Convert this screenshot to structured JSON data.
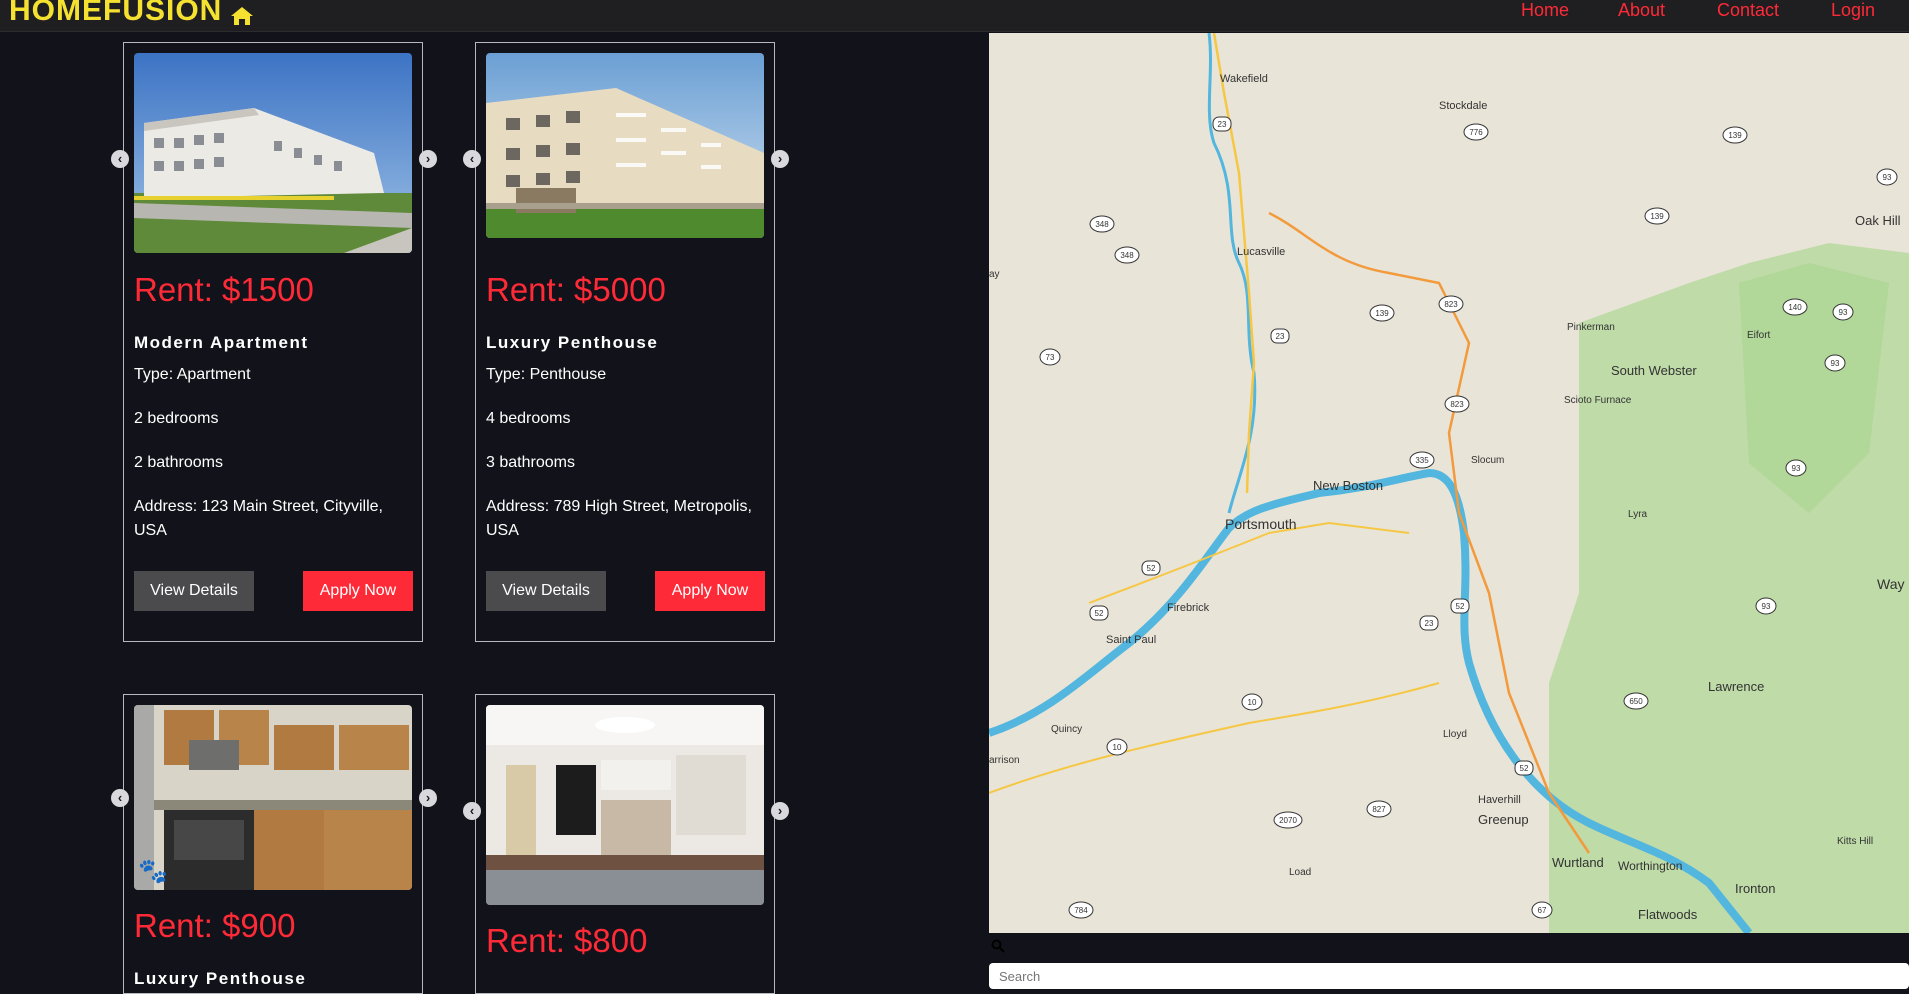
{
  "header": {
    "brand": "HOMEFUSION",
    "nav": [
      "Home",
      "About",
      "Contact",
      "Login"
    ]
  },
  "listings": [
    {
      "rent": "Rent: $1500",
      "title": "Modern Apartment",
      "type": "Type: Apartment",
      "bedrooms": "2 bedrooms",
      "bathrooms": "2 bathrooms",
      "address": "Address: 123 Main Street, Cityville, USA",
      "details_label": "View Details",
      "apply_label": "Apply Now"
    },
    {
      "rent": "Rent: $5000",
      "title": "Luxury Penthouse",
      "type": "Type: Penthouse",
      "bedrooms": "4 bedrooms",
      "bathrooms": "3 bathrooms",
      "address": "Address: 789 High Street, Metropolis, USA",
      "details_label": "View Details",
      "apply_label": "Apply Now"
    },
    {
      "rent": "Rent: $900",
      "title": "Luxury Penthouse"
    },
    {
      "rent": "Rent: $800"
    }
  ],
  "map": {
    "places": [
      "Wakefield",
      "Stockdale",
      "Oak Hill",
      "Lucasville",
      "Pinkerman",
      "Eifort",
      "South Webster",
      "Scioto Furnace",
      "Slocum",
      "New Boston",
      "Portsmouth",
      "Lyra",
      "Firebrick",
      "Saint Paul",
      "Lawrence",
      "Quincy",
      "Lloyd",
      "Haverhill",
      "Greenup",
      "Wurtland",
      "Worthington",
      "Ironton",
      "Flatwoods",
      "Kitts Hill",
      "Load",
      "Way",
      "arrison",
      "ay"
    ],
    "routes": [
      "23",
      "776",
      "139",
      "93",
      "348",
      "348",
      "139",
      "823",
      "139",
      "140",
      "93",
      "23",
      "73",
      "93",
      "823",
      "335",
      "93",
      "52",
      "52",
      "23",
      "52",
      "93",
      "10",
      "650",
      "10",
      "52",
      "2070",
      "827",
      "67",
      "784"
    ]
  },
  "search": {
    "placeholder": "Search"
  },
  "colors": {
    "accent": "#ff2a37",
    "brand": "#f5e12f",
    "background": "#12131a"
  }
}
